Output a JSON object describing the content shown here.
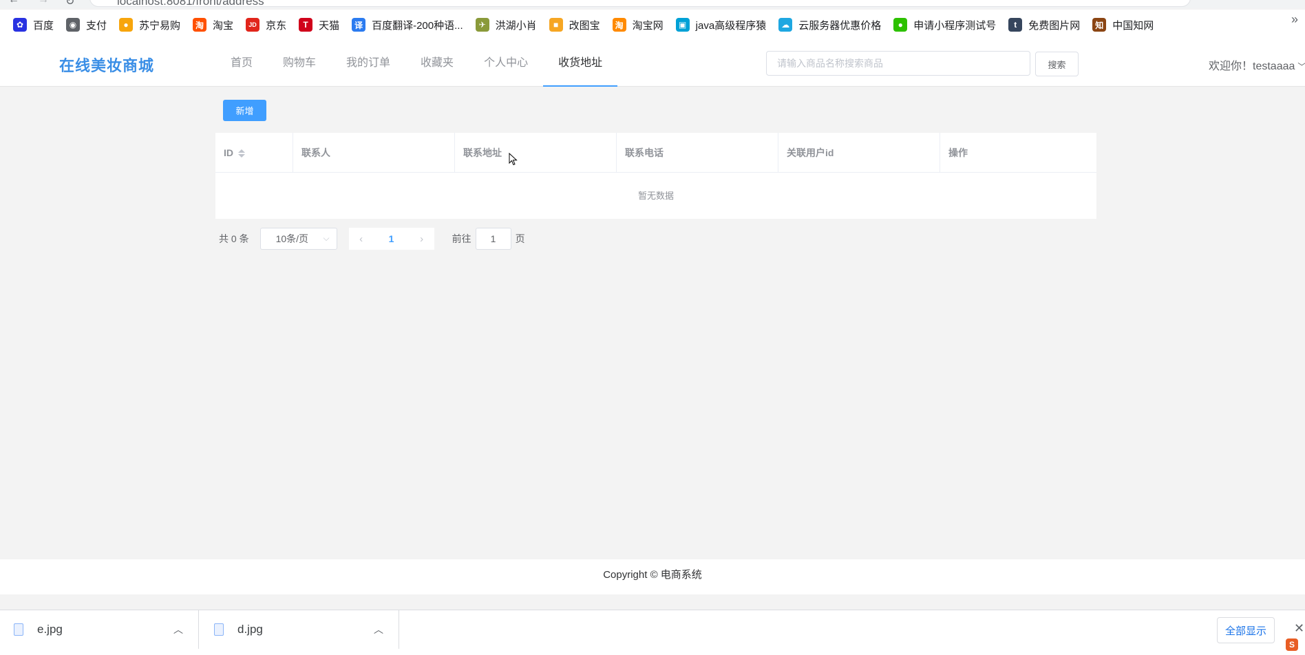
{
  "browser": {
    "url": "localhost:8081/front/address",
    "bookmarks": [
      {
        "label": "百度",
        "icon": "baidu-paw-icon",
        "color": "#2932e1",
        "glyph": "✿"
      },
      {
        "label": "支付",
        "icon": "globe-icon",
        "color": "#5f6368",
        "glyph": "◉"
      },
      {
        "label": "苏宁易购",
        "icon": "suning-lion-icon",
        "color": "#f7a50c",
        "glyph": "●"
      },
      {
        "label": "淘宝",
        "icon": "taobao-icon",
        "color": "#ff5000",
        "glyph": "淘"
      },
      {
        "label": "京东",
        "icon": "jd-icon",
        "color": "#e1251b",
        "glyph": "JD"
      },
      {
        "label": "天猫",
        "icon": "tmall-icon",
        "color": "#d0021b",
        "glyph": "T"
      },
      {
        "label": "百度翻译-200种语...",
        "icon": "translate-icon",
        "color": "#2b7bf0",
        "glyph": "译"
      },
      {
        "label": "洪湖小肖",
        "icon": "bird-icon",
        "color": "#8a9a3a",
        "glyph": "✈"
      },
      {
        "label": "改图宝",
        "icon": "gaitubao-icon",
        "color": "#f6a623",
        "glyph": "■"
      },
      {
        "label": "淘宝网",
        "icon": "taobao-icon",
        "color": "#ff8a00",
        "glyph": "淘"
      },
      {
        "label": "java高级程序猿",
        "icon": "bilibili-icon",
        "color": "#00a1d6",
        "glyph": "▣"
      },
      {
        "label": "云服务器优惠价格",
        "icon": "cloud-icon",
        "color": "#1ea7e1",
        "glyph": "☁"
      },
      {
        "label": "申请小程序测试号",
        "icon": "wechat-icon",
        "color": "#2dc100",
        "glyph": "●"
      },
      {
        "label": "免费图片网",
        "icon": "tumblr-icon",
        "color": "#36465d",
        "glyph": "t"
      },
      {
        "label": "中国知网",
        "icon": "cnki-icon",
        "color": "#8b4513",
        "glyph": "知"
      }
    ],
    "more": "»"
  },
  "header": {
    "logo": "在线美妆商城",
    "nav": [
      "首页",
      "购物车",
      "我的订单",
      "收藏夹",
      "个人中心",
      "收货地址"
    ],
    "active_nav": "收货地址",
    "search_placeholder": "请输入商品名称搜索商品",
    "search_button": "搜索",
    "welcome": "欢迎你！testaaaa"
  },
  "main": {
    "add_button": "新增",
    "columns": [
      "ID",
      "联系人",
      "联系地址",
      "联系电话",
      "关联用户id",
      "操作"
    ],
    "empty_text": "暂无数据",
    "pagination": {
      "total": "共 0 条",
      "page_size": "10条/页",
      "current_page": "1",
      "goto_label": "前往",
      "goto_value": "1",
      "page_suffix": "页"
    }
  },
  "footer": {
    "copyright": "Copyright © 电商系统"
  },
  "downloads": {
    "items": [
      "e.jpg",
      "d.jpg"
    ],
    "show_all": "全部显示"
  }
}
